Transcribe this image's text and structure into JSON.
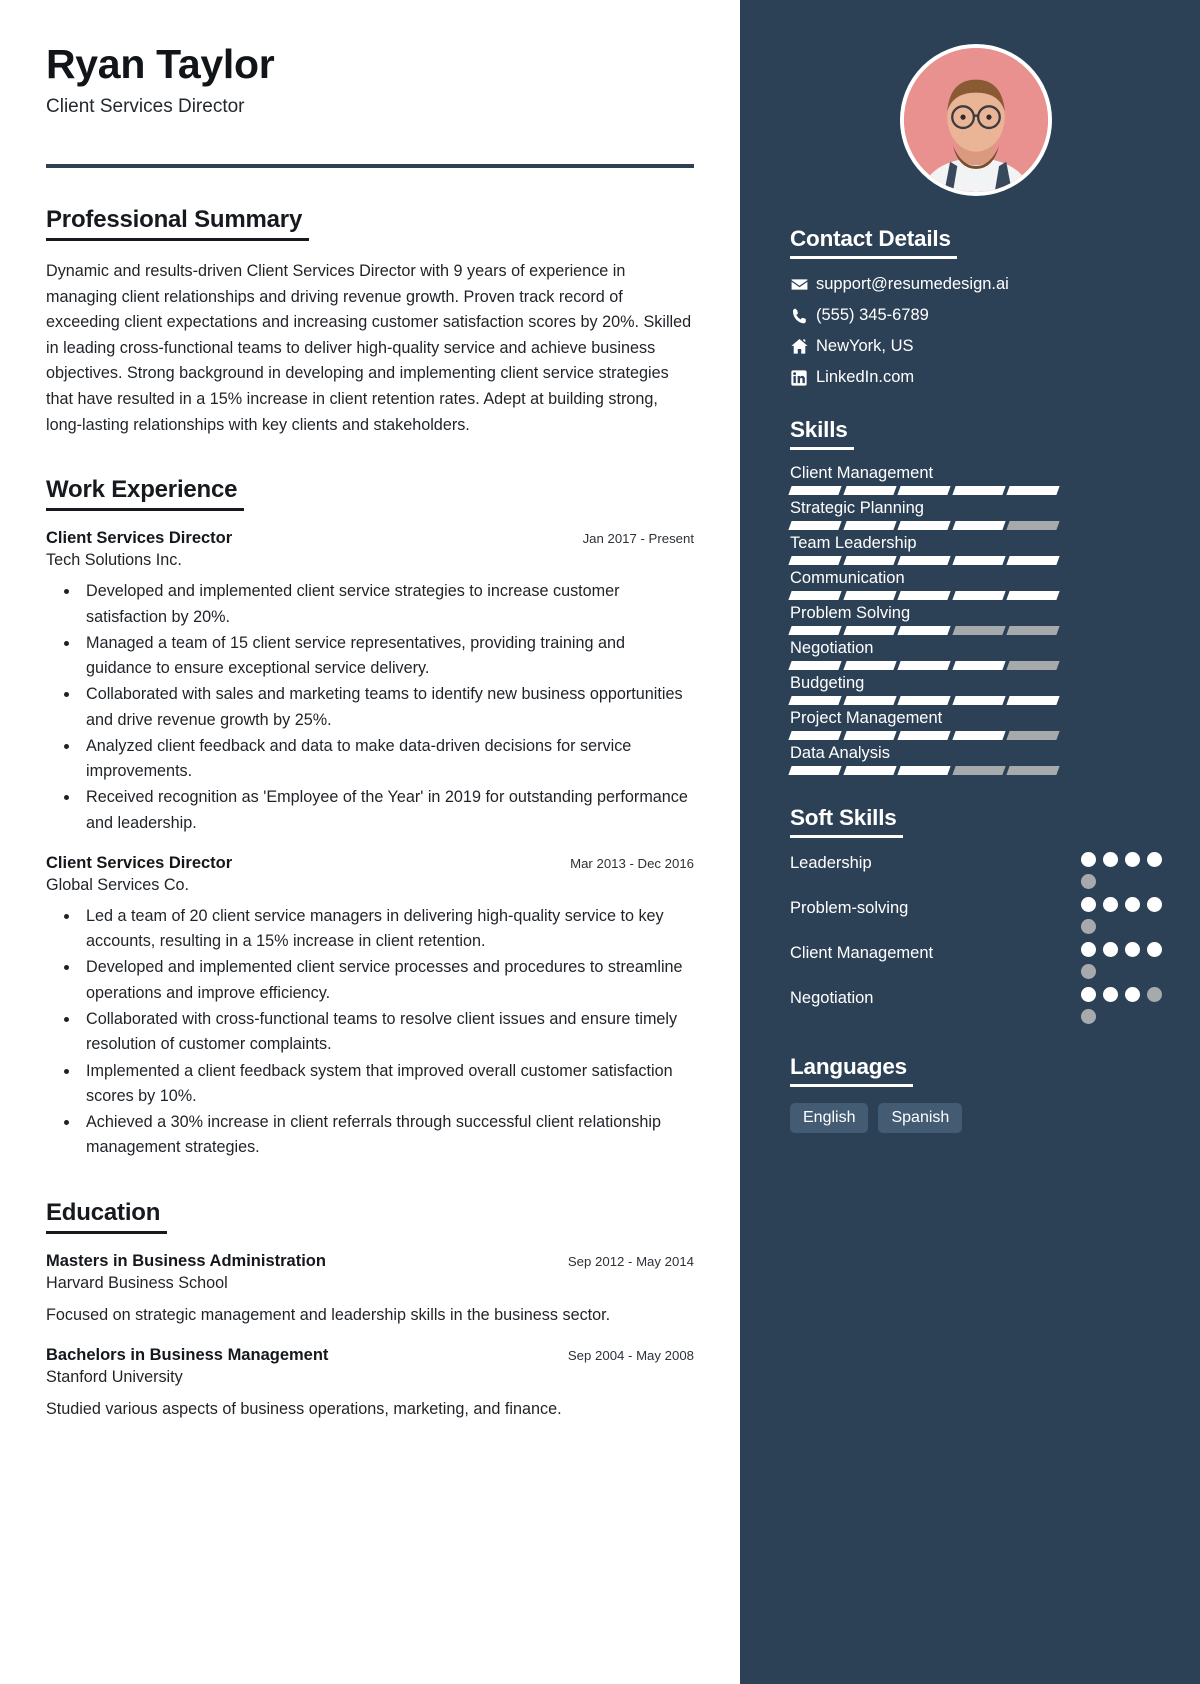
{
  "header": {
    "name": "Ryan Taylor",
    "role": "Client Services Director"
  },
  "theme": {
    "sidebar_bg": "#2d4156",
    "rule": "#2e4054",
    "avatar_bg": "#e8918f",
    "bar_on": "#ffffff",
    "bar_off": "#a7aaad",
    "pill_bg": "#435c74"
  },
  "sections": {
    "summary_title": "Professional Summary",
    "summary_text": "Dynamic and results-driven Client Services Director with 9 years of experience in managing client relationships and driving revenue growth. Proven track record of exceeding client expectations and increasing customer satisfaction scores by 20%. Skilled in leading cross-functional teams to deliver high-quality service and achieve business objectives. Strong background in developing and implementing client service strategies that have resulted in a 15% increase in client retention rates. Adept at building strong, long-lasting relationships with key clients and stakeholders.",
    "work_title": "Work Experience",
    "education_title": "Education"
  },
  "work": [
    {
      "title": "Client Services Director",
      "date": "Jan 2017 - Present",
      "org": "Tech Solutions Inc.",
      "bullets": [
        "Developed and implemented client service strategies to increase customer satisfaction by 20%.",
        "Managed a team of 15 client service representatives, providing training and guidance to ensure exceptional service delivery.",
        "Collaborated with sales and marketing teams to identify new business opportunities and drive revenue growth by 25%.",
        "Analyzed client feedback and data to make data-driven decisions for service improvements.",
        "Received recognition as 'Employee of the Year' in 2019 for outstanding performance and leadership."
      ]
    },
    {
      "title": "Client Services Director",
      "date": "Mar 2013 - Dec 2016",
      "org": "Global Services Co.",
      "bullets": [
        "Led a team of 20 client service managers in delivering high-quality service to key accounts, resulting in a 15% increase in client retention.",
        "Developed and implemented client service processes and procedures to streamline operations and improve efficiency.",
        "Collaborated with cross-functional teams to resolve client issues and ensure timely resolution of customer complaints.",
        "Implemented a client feedback system that improved overall customer satisfaction scores by 10%.",
        "Achieved a 30% increase in client referrals through successful client relationship management strategies."
      ]
    }
  ],
  "education": [
    {
      "degree": "Masters in Business Administration",
      "date": "Sep 2012 - May 2014",
      "school": "Harvard Business School",
      "desc": "Focused on strategic management and leadership skills in the business sector."
    },
    {
      "degree": "Bachelors in Business Management",
      "date": "Sep 2004 - May 2008",
      "school": "Stanford University",
      "desc": "Studied various aspects of business operations, marketing, and finance."
    }
  ],
  "sidebar": {
    "contact_title": "Contact Details",
    "contacts": [
      {
        "icon": "envelope-icon",
        "text": "support@resumedesign.ai"
      },
      {
        "icon": "phone-icon",
        "text": "(555) 345-6789"
      },
      {
        "icon": "home-icon",
        "text": "NewYork, US"
      },
      {
        "icon": "linkedin-icon",
        "text": "LinkedIn.com"
      }
    ],
    "skills_title": "Skills",
    "skills_max": 5,
    "skills": [
      {
        "name": "Client Management",
        "level": 5
      },
      {
        "name": "Strategic Planning",
        "level": 4
      },
      {
        "name": "Team Leadership",
        "level": 5
      },
      {
        "name": "Communication",
        "level": 5
      },
      {
        "name": "Problem Solving",
        "level": 3
      },
      {
        "name": "Negotiation",
        "level": 4
      },
      {
        "name": "Budgeting",
        "level": 5
      },
      {
        "name": "Project Management",
        "level": 4
      },
      {
        "name": "Data Analysis",
        "level": 3
      }
    ],
    "soft_title": "Soft Skills",
    "soft_max": 5,
    "soft_skills": [
      {
        "name": "Leadership",
        "level": 4
      },
      {
        "name": "Problem-solving",
        "level": 4
      },
      {
        "name": "Client Management",
        "level": 4
      },
      {
        "name": "Negotiation",
        "level": 3
      }
    ],
    "lang_title": "Languages",
    "languages": [
      "English",
      "Spanish"
    ]
  }
}
